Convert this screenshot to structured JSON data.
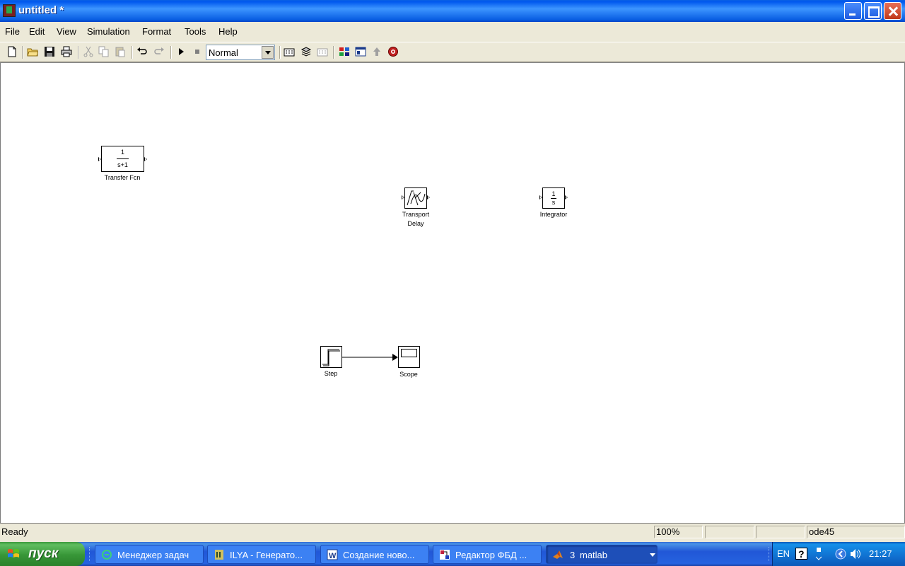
{
  "window": {
    "title": "untitled *"
  },
  "menu": {
    "items": [
      "File",
      "Edit",
      "View",
      "Simulation",
      "Format",
      "Tools",
      "Help"
    ]
  },
  "toolbar": {
    "icons": [
      "new-icon",
      "open-icon",
      "save-icon",
      "print-icon",
      "cut-icon",
      "copy-icon",
      "paste-icon",
      "undo-icon",
      "redo-icon",
      "start-simulation-icon",
      "stop-simulation-icon",
      "build-icon",
      "update-diagram-icon",
      "build-subsystem-icon",
      "library-browser-icon",
      "model-explorer-icon",
      "go-to-parent-icon",
      "debug-icon"
    ],
    "mode": "Normal"
  },
  "blocks": {
    "transfer_fcn": {
      "num": "1",
      "den": "s+1",
      "label": "Transfer Fcn"
    },
    "transport_delay": {
      "label_line1": "Transport",
      "label_line2": "Delay"
    },
    "integrator": {
      "num": "1",
      "den": "s",
      "label": "Integrator"
    },
    "step": {
      "label": "Step"
    },
    "scope": {
      "label": "Scope"
    }
  },
  "status": {
    "text": "Ready",
    "zoom": "100%",
    "pane3": "",
    "pane4": "",
    "solver": "ode45"
  },
  "taskbar": {
    "start_label": "пуск",
    "tasks": [
      {
        "label": "Менеджер задач",
        "icon": "task-manager-icon"
      },
      {
        "label": "ILYA - Генерато...",
        "icon": "ilya-app-icon"
      },
      {
        "label": "Создание ново...",
        "icon": "word-icon"
      },
      {
        "label": "Редактор ФБД ...",
        "icon": "fbd-editor-icon"
      },
      {
        "label": "matlab",
        "count": "3",
        "icon": "matlab-icon"
      }
    ],
    "tray": {
      "language": "EN",
      "clock": "21:27"
    }
  },
  "colors": {
    "titlebar": "#0a5fe3",
    "canvas": "#ffffff",
    "chrome": "#ece9d8",
    "taskbar": "#2157d7",
    "start_button": "#379637"
  }
}
